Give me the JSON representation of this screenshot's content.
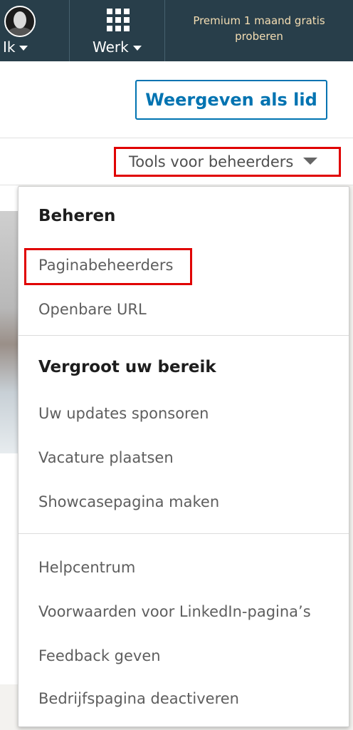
{
  "topnav": {
    "me_label": "Ik",
    "work_label": "Werk",
    "premium_line1": "Premium 1 maand gratis",
    "premium_line2": "proberen"
  },
  "header": {
    "view_as_member": "Weergeven als lid"
  },
  "toolbar": {
    "admin_tools": "Tools voor beheerders"
  },
  "dropdown": {
    "manage": {
      "title": "Beheren",
      "items": [
        "Paginabeheerders",
        "Openbare URL"
      ]
    },
    "reach": {
      "title": "Vergroot uw bereik",
      "items": [
        "Uw updates sponsoren",
        "Vacature plaatsen",
        "Showcasepagina maken"
      ]
    },
    "support": {
      "items": [
        "Helpcentrum",
        "Voorwaarden voor LinkedIn-pagina’s",
        "Feedback geven",
        "Bedrijfspagina deactiveren"
      ]
    }
  },
  "colors": {
    "nav_bg": "#283e4a",
    "brand_blue": "#0073b1",
    "highlight_red": "#e00000"
  }
}
